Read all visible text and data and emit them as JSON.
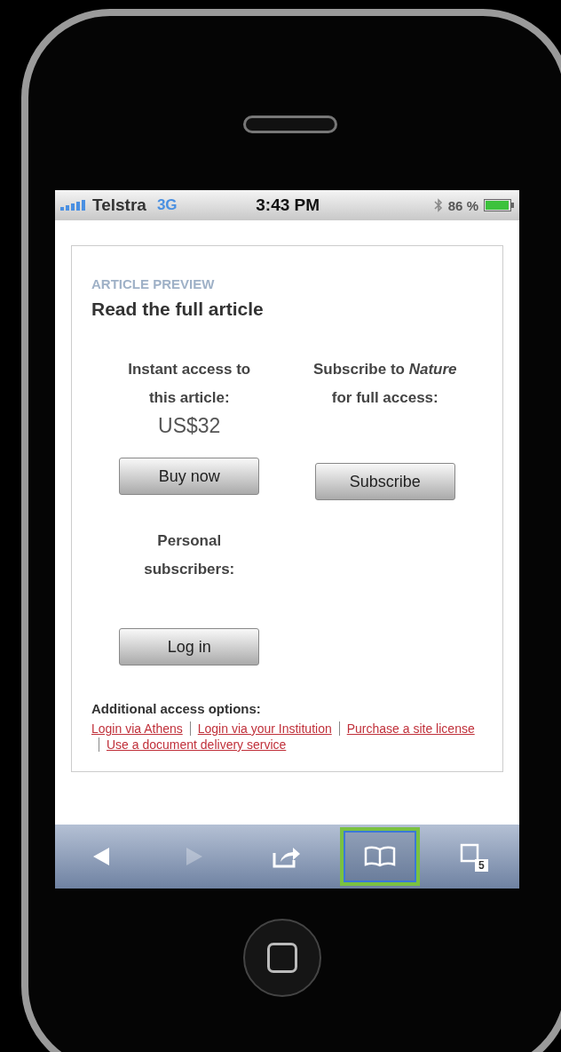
{
  "status_bar": {
    "carrier": "Telstra",
    "network": "3G",
    "time": "3:43 PM",
    "battery": "86 %"
  },
  "preview": {
    "eyebrow": "ARTICLE PREVIEW",
    "title": "Read the full article",
    "options": [
      {
        "text": "Instant access to this article:",
        "price": "US$32",
        "button": "Buy now"
      },
      {
        "text": "Subscribe to *Nature* for full access:",
        "button": "Subscribe"
      },
      {
        "text": "Personal subscribers:",
        "button": "Log in"
      }
    ],
    "additional_heading": "Additional access options:",
    "links": [
      "Login via Athens",
      "Login via your Institution",
      "Purchase a site license",
      "Use a document delivery service"
    ]
  },
  "toolbar": [
    {
      "kind": "back",
      "disabled": false,
      "selected": false
    },
    {
      "kind": "forward",
      "disabled": true,
      "selected": false
    },
    {
      "kind": "share",
      "disabled": false,
      "selected": false
    },
    {
      "kind": "bookmarks",
      "disabled": false,
      "selected": true
    },
    {
      "kind": "tabs",
      "disabled": false,
      "selected": false,
      "count": "5"
    }
  ]
}
